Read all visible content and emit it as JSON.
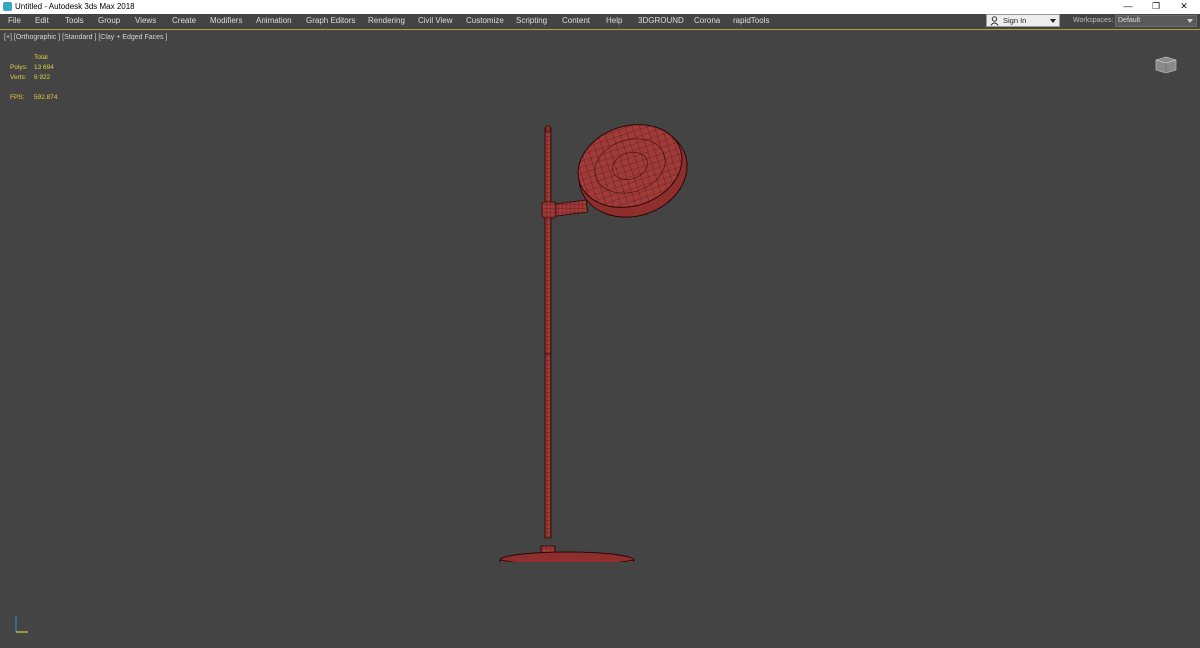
{
  "window": {
    "title": "Untitled - Autodesk 3ds Max 2018",
    "controls": {
      "minimize": "—",
      "restore": "❐",
      "close": "✕"
    }
  },
  "menu": {
    "items": [
      "File",
      "Edit",
      "Tools",
      "Group",
      "Views",
      "Create",
      "Modifiers",
      "Animation",
      "Graph Editors",
      "Rendering",
      "Civil View",
      "Customize",
      "Scripting",
      "Content",
      "Help",
      "3DGROUND",
      "Corona",
      "rapidTools"
    ],
    "sign_in": "Sign In",
    "workspaces_label": "Workspaces:",
    "workspace_value": "Default"
  },
  "viewport": {
    "label": "[+] [Orthographic ] [Standard ] [Clay + Edged Faces ]",
    "stats": {
      "header": "Total",
      "polys_label": "Polys:",
      "polys_value": "13 694",
      "verts_label": "Verts:",
      "verts_value": "6 922",
      "fps_label": "FPS:",
      "fps_value": "592,874"
    }
  },
  "colors": {
    "background": "#444444",
    "stats_text": "#e3cf42",
    "model_fill": "#a03a38",
    "wire": "#3a0f0f",
    "accent_line": "#b89b45"
  },
  "icons": {
    "app": "3ds-max-app-icon",
    "user": "user-icon",
    "viewcube": "viewcube-icon",
    "axis": "axis-tripod-icon"
  }
}
